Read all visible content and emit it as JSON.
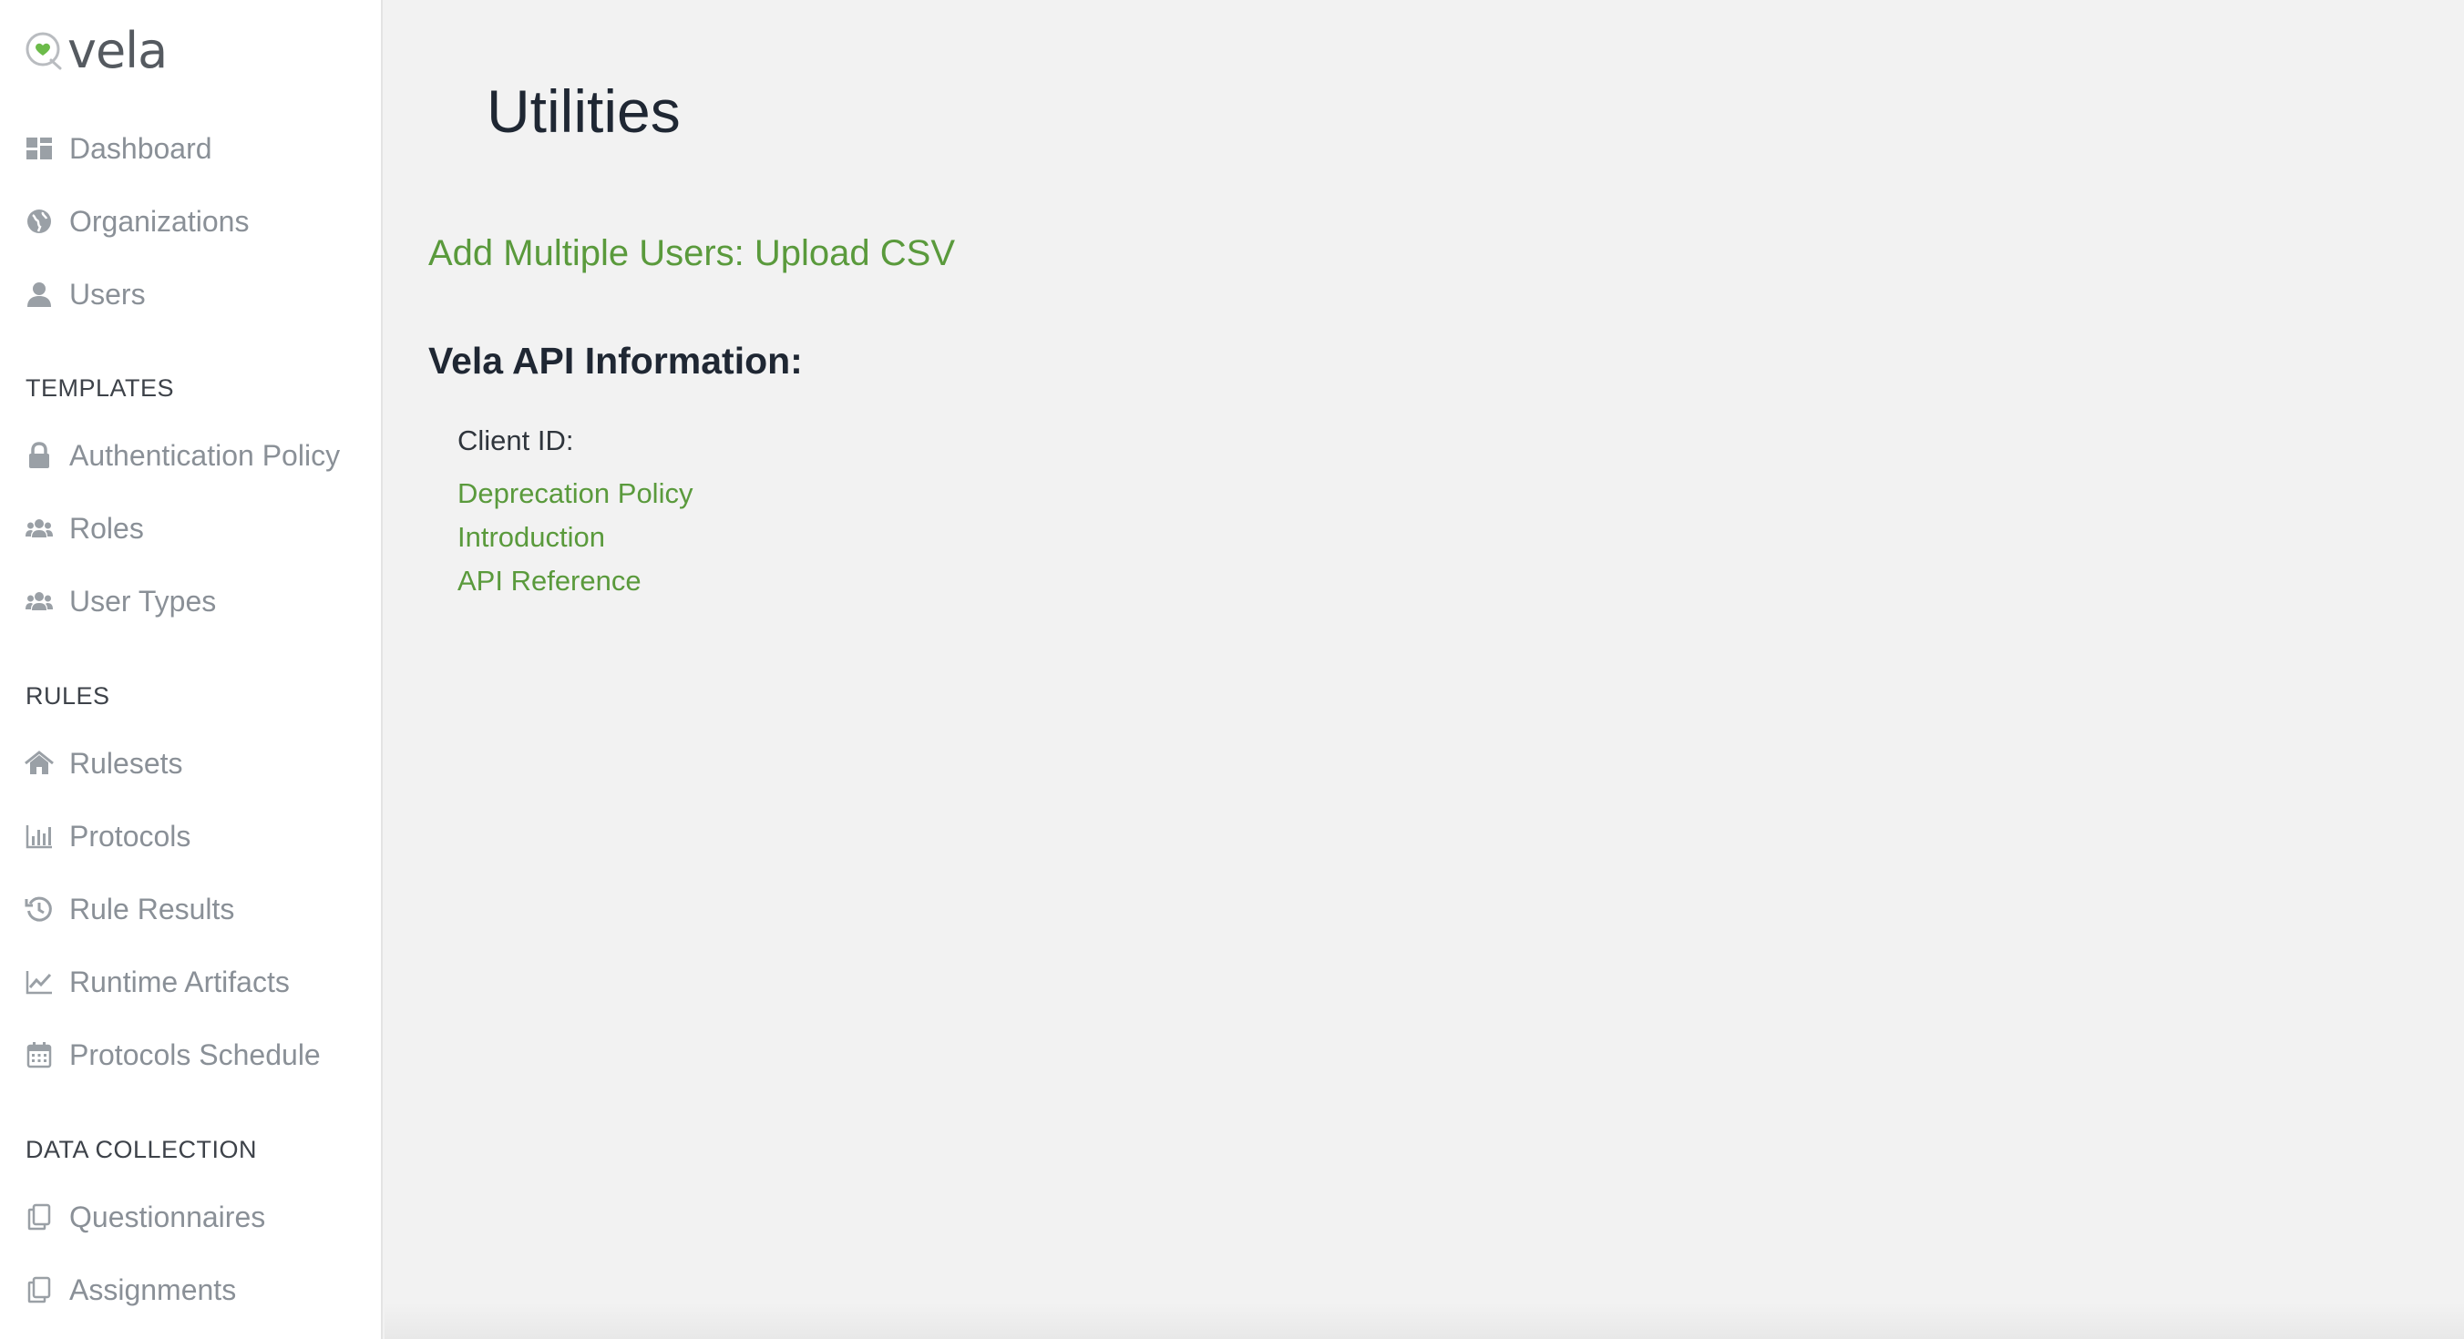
{
  "brand": {
    "name": "vela",
    "accent": "#5a9a3c"
  },
  "sidebar": {
    "top_items": [
      {
        "label": "Dashboard",
        "icon": "dashboard-icon"
      },
      {
        "label": "Organizations",
        "icon": "globe-icon"
      },
      {
        "label": "Users",
        "icon": "user-icon"
      }
    ],
    "sections": [
      {
        "heading": "TEMPLATES",
        "items": [
          {
            "label": "Authentication Policy",
            "icon": "lock-icon"
          },
          {
            "label": "Roles",
            "icon": "users-icon"
          },
          {
            "label": "User Types",
            "icon": "users-icon"
          }
        ]
      },
      {
        "heading": "RULES",
        "items": [
          {
            "label": "Rulesets",
            "icon": "home-icon"
          },
          {
            "label": "Protocols",
            "icon": "bar-chart-icon"
          },
          {
            "label": "Rule Results",
            "icon": "history-icon"
          },
          {
            "label": "Runtime Artifacts",
            "icon": "line-chart-icon"
          },
          {
            "label": "Protocols Schedule",
            "icon": "calendar-icon"
          }
        ]
      },
      {
        "heading": "DATA COLLECTION",
        "items": [
          {
            "label": "Questionnaires",
            "icon": "copy-icon"
          },
          {
            "label": "Assignments",
            "icon": "copy-icon"
          }
        ]
      }
    ]
  },
  "main": {
    "title": "Utilities",
    "upload_link": "Add Multiple Users: Upload CSV",
    "api_heading": "Vela API Information:",
    "client_id_label": "Client ID:",
    "api_links": [
      "Deprecation Policy",
      "Introduction",
      "API Reference"
    ]
  }
}
